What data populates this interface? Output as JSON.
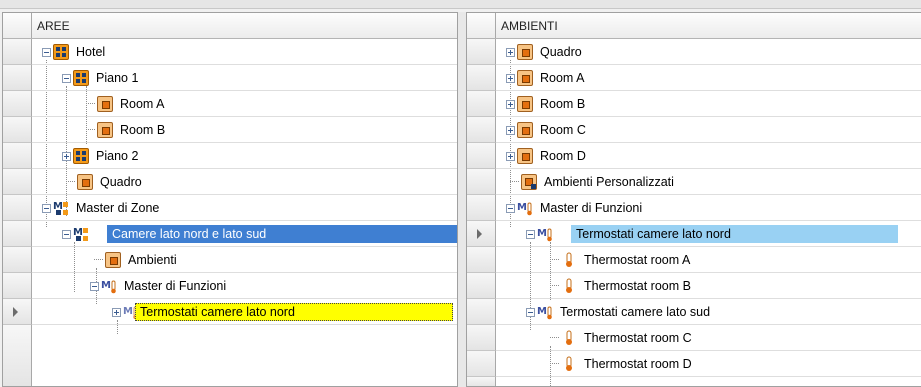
{
  "left_panel": {
    "header": "AREE",
    "tree": [
      {
        "label": "Hotel",
        "icon": "zone-grid-icon"
      },
      {
        "label": "Piano 1",
        "icon": "zone-grid-icon"
      },
      {
        "label": "Room A",
        "icon": "room-icon"
      },
      {
        "label": "Room B",
        "icon": "room-icon"
      },
      {
        "label": "Piano 2",
        "icon": "zone-grid-icon"
      },
      {
        "label": "Quadro",
        "icon": "room-icon"
      },
      {
        "label": "Master di Zone",
        "icon": "master-zone-icon"
      },
      {
        "label": "Camere lato nord e lato sud",
        "icon": "master-zone-icon",
        "selected": true
      },
      {
        "label": "Ambienti",
        "icon": "room-icon"
      },
      {
        "label": "Master di Funzioni",
        "icon": "master-function-icon"
      },
      {
        "label": "Termostati camere lato nord",
        "icon": "master-function-icon"
      }
    ]
  },
  "right_panel": {
    "header": "AMBIENTI",
    "tree": [
      {
        "label": "Quadro",
        "icon": "room-icon"
      },
      {
        "label": "Room A",
        "icon": "room-icon"
      },
      {
        "label": "Room B",
        "icon": "room-icon"
      },
      {
        "label": "Room C",
        "icon": "room-icon"
      },
      {
        "label": "Room D",
        "icon": "room-icon"
      },
      {
        "label": "Ambienti Personalizzati",
        "icon": "custom-rooms-icon"
      },
      {
        "label": "Master di Funzioni",
        "icon": "master-function-icon"
      },
      {
        "label": "Termostati camere lato nord",
        "icon": "master-function-icon",
        "selected": true
      },
      {
        "label": "Thermostat room A",
        "icon": "thermometer-icon"
      },
      {
        "label": "Thermostat room B",
        "icon": "thermometer-icon"
      },
      {
        "label": "Termostati camere lato sud",
        "icon": "master-function-icon"
      },
      {
        "label": "Thermostat room C",
        "icon": "thermometer-icon"
      },
      {
        "label": "Thermostat room D",
        "icon": "thermometer-icon"
      }
    ]
  },
  "colors": {
    "selection_blue": "#3f7fd2",
    "selection_light": "#99d1f3",
    "highlight_yellow": "#ffff00",
    "room_orange": "#f39a1a",
    "navy": "#1c3b6e"
  }
}
